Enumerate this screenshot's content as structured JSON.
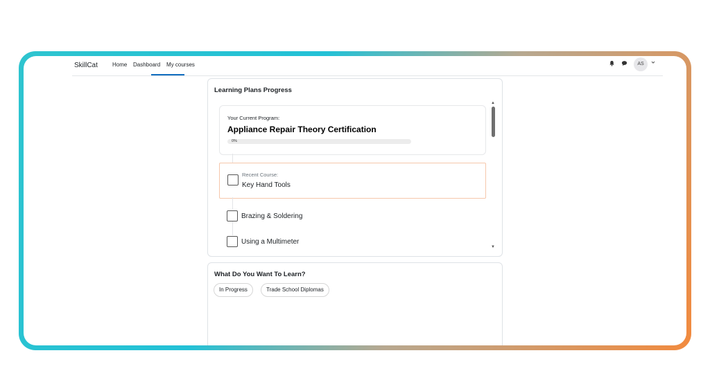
{
  "navbar": {
    "brand": "SkillCat",
    "links": [
      "Home",
      "Dashboard",
      "My courses"
    ],
    "active_link": "Dashboard",
    "bell_icon": "bell-icon",
    "chat_icon": "chat-icon",
    "avatar_initials": "AS",
    "chevron_icon": "chevron-down-icon"
  },
  "learning_plans": {
    "title": "Learning Plans Progress",
    "program_label": "Your Current Program:",
    "program_title": "Appliance Repair Theory Certification",
    "progress_percent": 0,
    "progress_text": "0%",
    "recent_label": "Recent Course:",
    "recent_course": "Key Hand Tools",
    "courses": [
      "Brazing & Soldering",
      "Using a Multimeter"
    ]
  },
  "learn": {
    "title": "What Do You Want To Learn?",
    "chips": [
      "In Progress",
      "Trade School Diplomas"
    ]
  },
  "colors": {
    "accent": "#0f6cbf",
    "highlight_border": "#f6c7ab",
    "frame_gradient_start": "#2ec4cf",
    "frame_gradient_end": "#f28a3e"
  }
}
